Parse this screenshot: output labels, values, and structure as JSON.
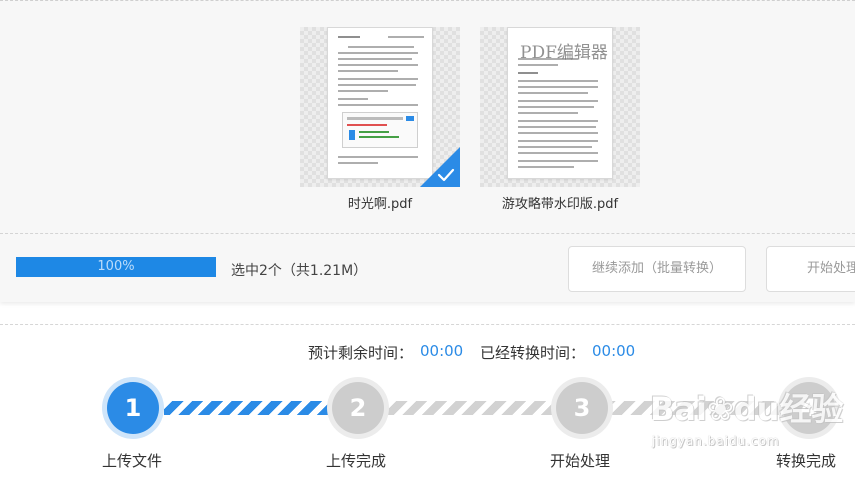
{
  "files": [
    {
      "name": "时光啊.pdf",
      "selected": true
    },
    {
      "name": "游攻略带水印版.pdf",
      "selected": false,
      "watermark_text": "PDF编辑器"
    }
  ],
  "progress": {
    "percent": 100,
    "label": "100%"
  },
  "selection_info": "选中2个（共1.21M）",
  "buttons": {
    "continue_add": "继续添加（批量转换）",
    "start": "开始处理"
  },
  "timer": {
    "remaining_label": "预计剩余时间：",
    "remaining_value": "00:00",
    "elapsed_label": "已经转换时间：",
    "elapsed_value": "00:00"
  },
  "steps": [
    {
      "number": "1",
      "label": "上传文件",
      "active": true
    },
    {
      "number": "2",
      "label": "上传完成",
      "active": false
    },
    {
      "number": "3",
      "label": "开始处理",
      "active": false
    },
    {
      "number": "4",
      "label": "转换完成",
      "active": false
    }
  ],
  "watermark": {
    "logo": "Bai❀du经验",
    "url": "jingyan.baidu.com"
  },
  "colors": {
    "accent": "#2b8be6",
    "inactive": "#cdcdcd"
  }
}
